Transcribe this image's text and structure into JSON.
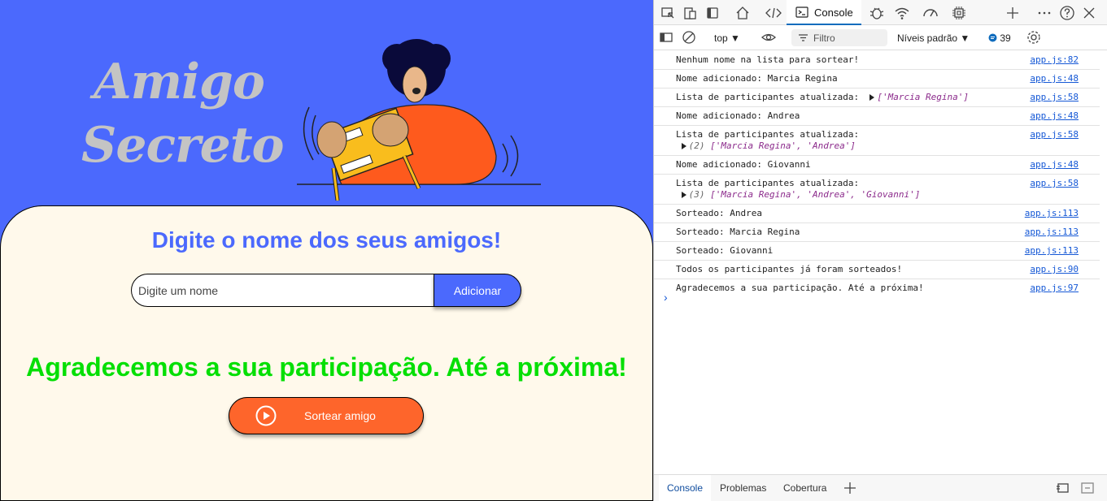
{
  "app": {
    "title_line1": "Amigo",
    "title_line2": "Secreto",
    "subtitle": "Digite o nome dos seus amigos!",
    "input_placeholder": "Digite um nome",
    "add_button": "Adicionar",
    "result_text": "Agradecemos a sua participação. Até a próxima!",
    "draw_button": "Sortear amigo",
    "colors": {
      "primary": "#4b69fd",
      "panel": "#fff9eb",
      "result": "#05df05",
      "draw_button": "#fe652b",
      "title": "#c4c4c4"
    }
  },
  "devtools": {
    "tabs": {
      "active": "Console"
    },
    "toolbar": {
      "context": "top",
      "filter_placeholder": "Filtro",
      "levels": "Níveis padrão",
      "message_count": "39"
    },
    "log": [
      {
        "text": "Nenhum nome na lista para sortear!",
        "source": "app.js:82"
      },
      {
        "text": "Nome adicionado: Marcia Regina",
        "source": "app.js:48"
      },
      {
        "text": "Lista de participantes atualizada:",
        "array": "['Marcia Regina']",
        "source": "app.js:58"
      },
      {
        "text": "Nome adicionado: Andrea",
        "source": "app.js:48"
      },
      {
        "text": "Lista de participantes atualizada:",
        "array_count": "(2)",
        "array": "['Marcia Regina', 'Andrea']",
        "source": "app.js:58"
      },
      {
        "text": "Nome adicionado: Giovanni",
        "source": "app.js:48"
      },
      {
        "text": "Lista de participantes atualizada:",
        "array_count": "(3)",
        "array": "['Marcia Regina', 'Andrea', 'Giovanni']",
        "source": "app.js:58"
      },
      {
        "text": "Sorteado: Andrea",
        "source": "app.js:113"
      },
      {
        "text": "Sorteado: Marcia Regina",
        "source": "app.js:113"
      },
      {
        "text": "Sorteado: Giovanni",
        "source": "app.js:113"
      },
      {
        "text": "Todos os participantes já foram sorteados!",
        "source": "app.js:90"
      },
      {
        "text": "Agradecemos a sua participação. Até a próxima!",
        "source": "app.js:97"
      }
    ],
    "prompt": "›",
    "bottom_tabs": [
      "Console",
      "Problemas",
      "Cobertura"
    ]
  }
}
